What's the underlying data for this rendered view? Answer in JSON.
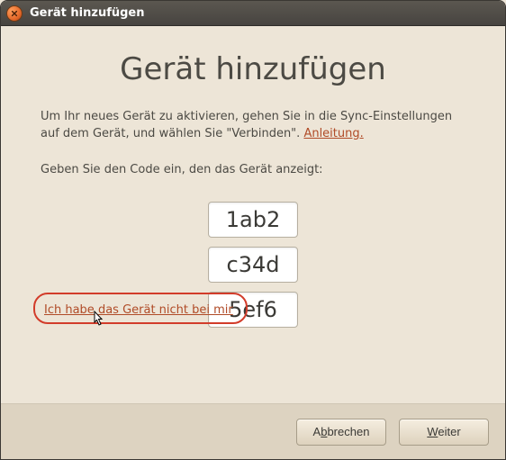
{
  "titlebar": {
    "title": "Gerät hinzufügen"
  },
  "heading": "Gerät hinzufügen",
  "instruction_pre": "Um Ihr neues Gerät zu aktivieren, gehen Sie in die Sync-Einstellungen auf dem Gerät, und wählen Sie \"Verbinden\". ",
  "instruction_link": "Anleitung.",
  "prompt": "Geben Sie den Code ein, den das Gerät anzeigt:",
  "codes": [
    "1ab2",
    "c34d",
    "5ef6"
  ],
  "no_device_link": "Ich habe das Gerät nicht bei mir",
  "buttons": {
    "cancel_pre": "A",
    "cancel_mn": "b",
    "cancel_post": "brechen",
    "next_mn": "W",
    "next_post": "eiter"
  }
}
